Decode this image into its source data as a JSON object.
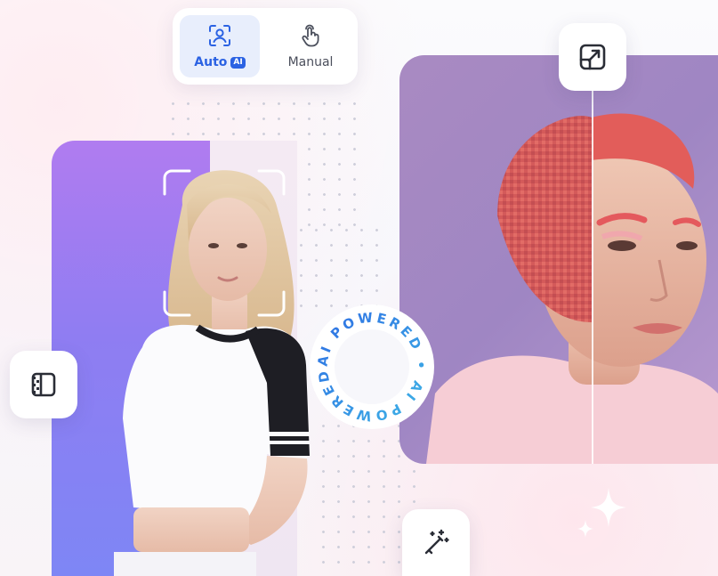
{
  "mode_toggle": {
    "auto": {
      "label": "Auto",
      "badge": "AI",
      "icon": "face-scan-icon",
      "selected": true
    },
    "manual": {
      "label": "Manual",
      "icon": "hand-pointer-icon",
      "selected": false
    }
  },
  "badge_ring": {
    "text": "AI POWERED • AI POWERED • "
  },
  "buttons": {
    "expand": {
      "icon": "expand-arrow-icon"
    },
    "compare": {
      "icon": "split-compare-icon"
    },
    "enhance": {
      "icon": "magic-wand-icon"
    }
  },
  "colors": {
    "accent": "#2b62e3",
    "panel_purple": "#9a7df2",
    "ring_gradient_start": "#2b62e3",
    "ring_gradient_end": "#3fb6e6"
  }
}
